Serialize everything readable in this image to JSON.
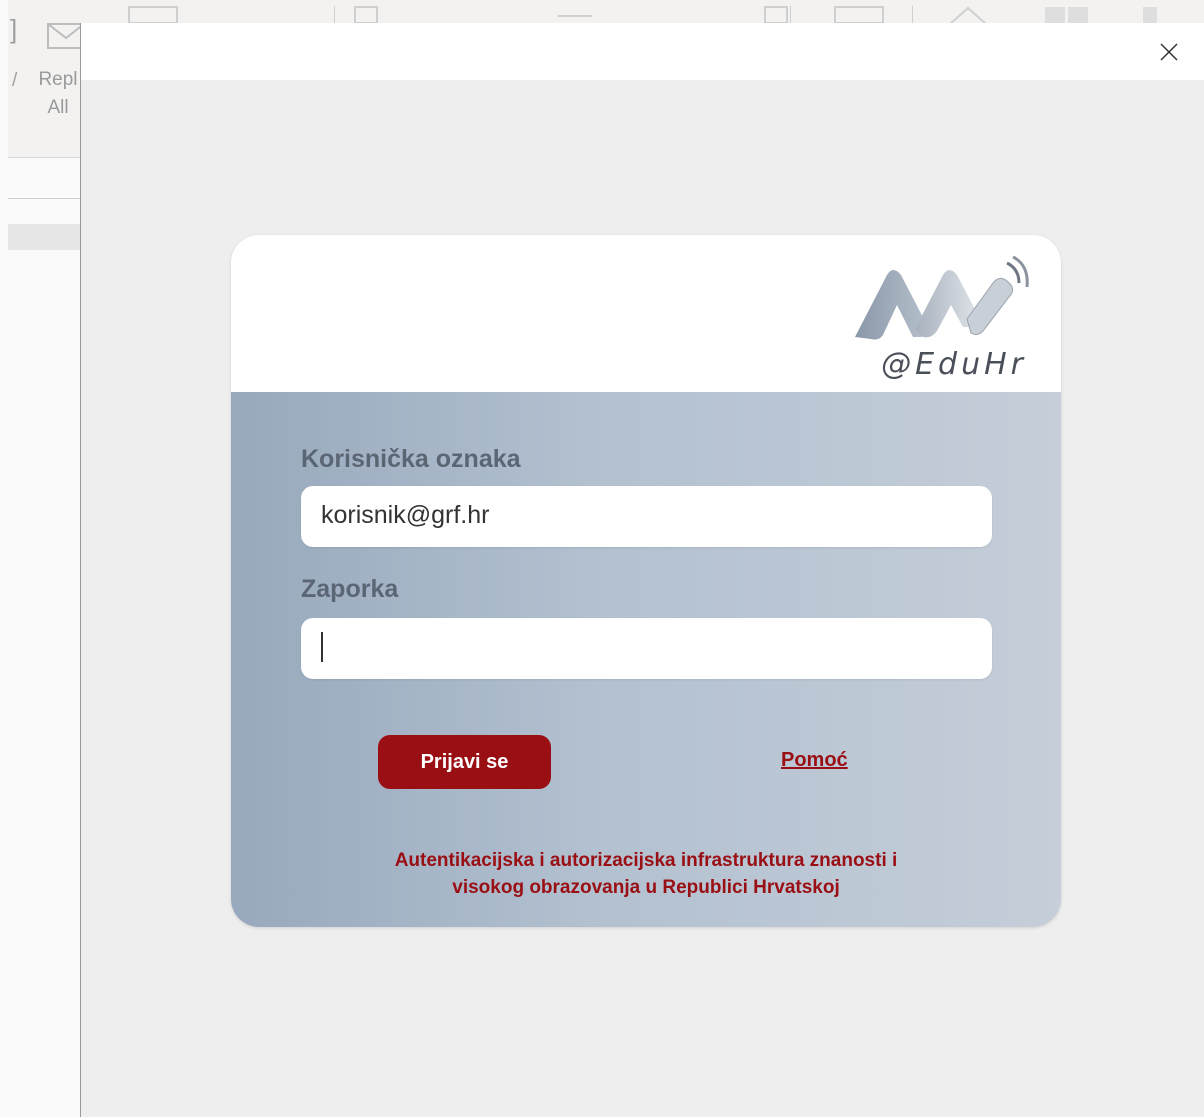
{
  "background_app": {
    "reply_all_label_line1": "Repl",
    "reply_all_label_line2": "All"
  },
  "dialog": {
    "close_icon": "close-icon"
  },
  "login": {
    "logo_text": "@EduHr",
    "username_label": "Korisnička oznaka",
    "username_value": "korisnik@grf.hr",
    "password_label": "Zaporka",
    "password_value": "",
    "login_button": "Prijavi se",
    "help_link": "Pomoć",
    "footer_line1": "Autentikacijska i autorizacijska infrastruktura znanosti i",
    "footer_line2": "visokog obrazovanja u Republici Hrvatskoj",
    "accent_color": "#9a0f14"
  }
}
